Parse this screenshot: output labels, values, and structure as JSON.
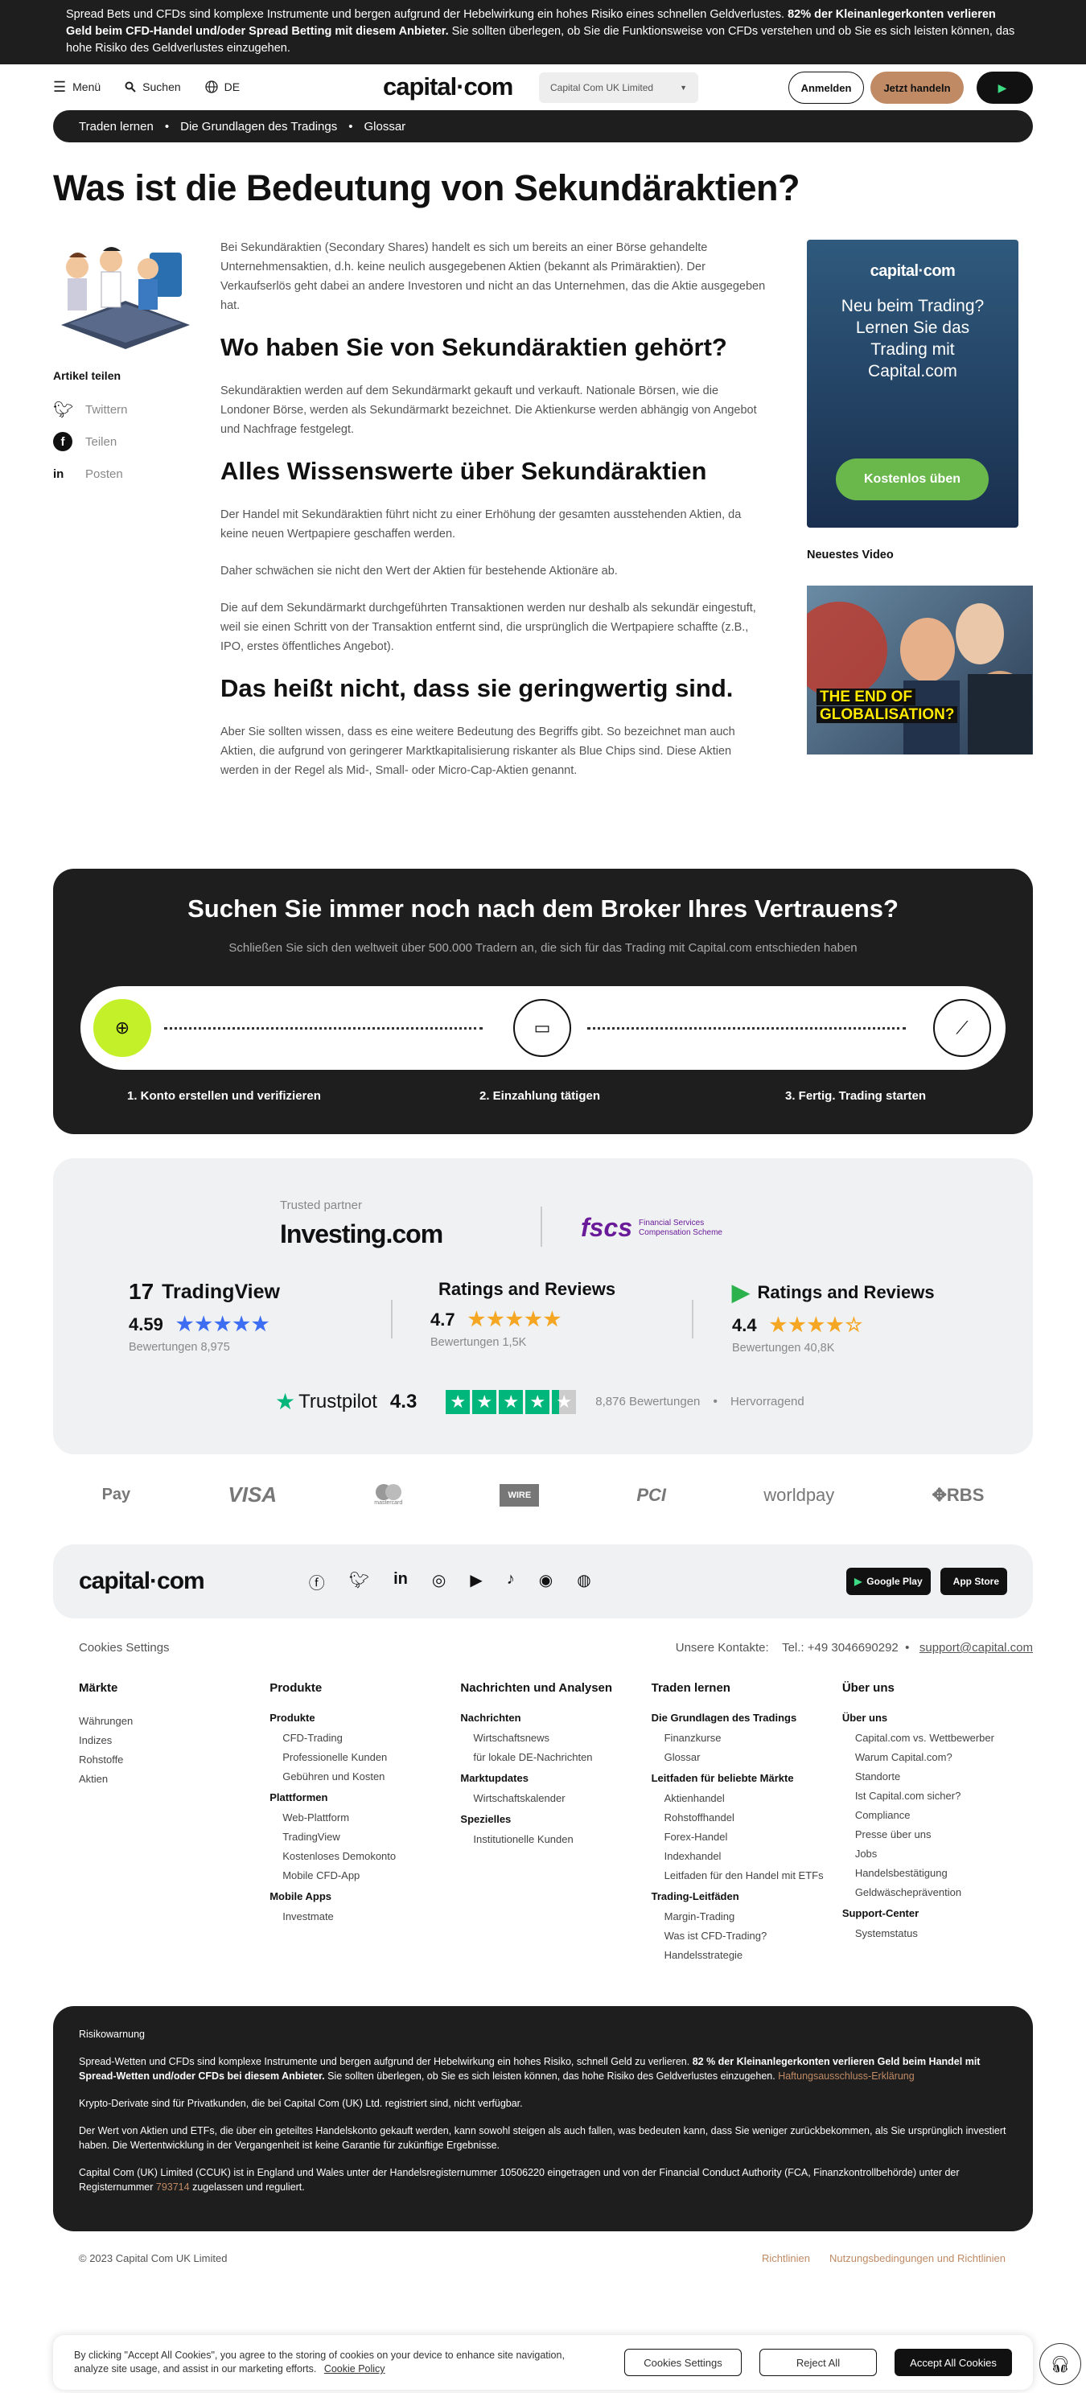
{
  "risk_banner": {
    "text": "Spread Bets und CFDs sind komplexe Instrumente und bergen aufgrund der Hebelwirkung ein hohes Risiko eines schnellen Geldverlustes.",
    "bold": "82% der Kleinanlegerkonten verlieren Geld beim CFD-Handel und/oder Spread Betting mit diesem Anbieter.",
    "rest": "Sie sollten überlegen, ob Sie die Funktionsweise von CFDs verstehen und ob Sie es sich leisten können, das hohe Risiko des Geldverlustes einzugehen."
  },
  "header": {
    "menu": "Menü",
    "search": "Suchen",
    "lang": "DE",
    "logo": "capital·com",
    "entity": "Capital Com UK Limited",
    "login": "Anmelden",
    "trade": "Jetzt handeln"
  },
  "breadcrumbs": [
    "Traden lernen",
    "Die Grundlagen des Tradings",
    "Glossar"
  ],
  "page_title": "Was ist die Bedeutung von Sekundäraktien?",
  "share": {
    "title": "Artikel teilen",
    "items": [
      "Twittern",
      "Teilen",
      "Posten"
    ]
  },
  "article": {
    "intro": "Bei Sekundäraktien (Secondary Shares) handelt es sich um bereits an einer Börse gehandelte Unternehmensaktien, d.h. keine neulich ausgegebenen Aktien (bekannt als Primäraktien). Der Verkaufserlös geht dabei an andere Investoren und nicht an das Unternehmen, das die Aktie ausgegeben hat.",
    "h2_1": "Wo haben Sie von Sekundäraktien gehört?",
    "p1": "Sekundäraktien werden auf dem Sekundärmarkt gekauft und verkauft. Nationale Börsen, wie die Londoner Börse, werden als Sekundärmarkt bezeichnet. Die Aktienkurse werden abhängig von Angebot und Nachfrage festgelegt.",
    "h2_2": "Alles Wissenswerte über Sekundäraktien",
    "p2": "Der Handel mit Sekundäraktien führt nicht zu einer Erhöhung der gesamten ausstehenden Aktien, da keine neuen Wertpapiere geschaffen werden.",
    "p3": "Daher schwächen sie nicht den Wert der Aktien für bestehende Aktionäre ab.",
    "p4": "Die auf dem Sekundärmarkt durchgeführten Transaktionen werden nur deshalb als sekundär eingestuft, weil sie einen Schritt von der Transaktion entfernt sind, die ursprünglich die Wertpapiere schaffte (z.B., IPO, erstes öffentliches Angebot).",
    "h2_3": "Das heißt nicht, dass sie geringwertig sind.",
    "p5": "Aber Sie sollten wissen, dass es eine weitere Bedeutung des Begriffs gibt. So bezeichnet man auch Aktien, die aufgrund von geringerer Marktkapitalisierung riskanter als Blue Chips sind. Diese Aktien werden in der Regel als Mid-, Small- oder Micro-Cap-Aktien genannt."
  },
  "promo": {
    "logo": "capital·com",
    "text": "Neu beim Trading? Lernen Sie das Trading mit Capital.com",
    "button": "Kostenlos üben"
  },
  "video": {
    "title": "Neuestes Video",
    "caption1": "THE END OF",
    "caption2": "GLOBALISATION?"
  },
  "broker": {
    "title": "Suchen Sie immer noch nach dem Broker Ihres Vertrauens?",
    "subtitle": "Schließen Sie sich den weltweit über 500.000 Tradern an, die sich für das Trading mit Capital.com entschieden haben",
    "steps": [
      "1. Konto erstellen und verifizieren",
      "2. Einzahlung tätigen",
      "3. Fertig. Trading starten"
    ]
  },
  "trust": {
    "partner_label": "Trusted partner",
    "partner": "Investing.com",
    "fscs": "fscs",
    "fscs_sub1": "Financial Services",
    "fscs_sub2": "Compensation Scheme",
    "ratings": [
      {
        "name": "TradingView",
        "score": "4.59",
        "count": "Bewertungen 8,975",
        "stars": "★★★★★",
        "star_color": "#3d6df2"
      },
      {
        "name": "Ratings and Reviews",
        "score": "4.7",
        "count": "Bewertungen 1,5K",
        "stars": "★★★★★",
        "star_color": "#f5a623"
      },
      {
        "name": "Ratings and Reviews",
        "score": "4.4",
        "count": "Bewertungen 40,8K",
        "stars": "★★★★☆",
        "star_color": "#f5a623"
      }
    ],
    "trustpilot": {
      "name": "Trustpilot",
      "score": "4.3",
      "count": "8,876 Bewertungen",
      "label": "Hervorragend"
    }
  },
  "payments": [
    "Pay",
    "VISA",
    "mastercard",
    "WIRE",
    "PCI",
    "worldpay",
    "RBS"
  ],
  "footer": {
    "logo": "capital·com",
    "google_play": "Google Play",
    "app_store": "App Store",
    "cookies": "Cookies Settings",
    "contacts_label": "Unsere Kontakte:",
    "phone": "Tel.: +49 3046690292",
    "email": "support@capital.com",
    "columns": [
      {
        "title": "Märkte",
        "groups": [
          {
            "sub": "",
            "items": [
              "Währungen",
              "Indizes",
              "Rohstoffe",
              "Aktien"
            ]
          }
        ]
      },
      {
        "title": "Produkte",
        "groups": [
          {
            "sub": "Produkte",
            "items": [
              "CFD-Trading",
              "Professionelle Kunden",
              "Gebühren und Kosten"
            ]
          },
          {
            "sub": "Plattformen",
            "items": [
              "Web-Plattform",
              "TradingView",
              "Kostenloses Demokonto",
              "Mobile CFD-App"
            ]
          },
          {
            "sub": "Mobile Apps",
            "items": [
              "Investmate"
            ]
          }
        ]
      },
      {
        "title": "Nachrichten und Analysen",
        "groups": [
          {
            "sub": "Nachrichten",
            "items": [
              "Wirtschaftsnews",
              "für lokale DE-Nachrichten"
            ]
          },
          {
            "sub": "Marktupdates",
            "items": [
              "Wirtschaftskalender"
            ]
          },
          {
            "sub": "Spezielles",
            "items": [
              "Institutionelle Kunden"
            ]
          }
        ]
      },
      {
        "title": "Traden lernen",
        "groups": [
          {
            "sub": "Die Grundlagen des Tradings",
            "items": [
              "Finanzkurse",
              "Glossar"
            ]
          },
          {
            "sub": "Leitfaden für beliebte Märkte",
            "items": [
              "Aktienhandel",
              "Rohstoffhandel",
              "Forex-Handel",
              "Indexhandel",
              "Leitfaden für den Handel mit ETFs"
            ]
          },
          {
            "sub": "Trading-Leitfäden",
            "items": [
              "Margin-Trading",
              "Was ist CFD-Trading?",
              "Handelsstrategie"
            ]
          }
        ]
      },
      {
        "title": "Über uns",
        "groups": [
          {
            "sub": "Über uns",
            "items": [
              "Capital.com vs. Wettbewerber",
              "Warum Capital.com?",
              "Standorte",
              "Ist Capital.com sicher?",
              "Compliance",
              "Presse über uns",
              "Jobs",
              "Handelsbestätigung",
              "Geldwäscheprävention"
            ]
          },
          {
            "sub": "Support-Center",
            "items": [
              "Systemstatus"
            ]
          }
        ]
      }
    ]
  },
  "risk_box": {
    "title": "Risikowarnung",
    "p1a": "Spread-Wetten und CFDs sind komplexe Instrumente und bergen aufgrund der Hebelwirkung ein hohes Risiko, schnell Geld zu verlieren.",
    "p1b": "82 % der Kleinanlegerkonten verlieren Geld beim Handel mit Spread-Wetten und/oder CFDs bei diesem Anbieter.",
    "p1c": "Sie sollten überlegen, ob Sie es sich leisten können, das hohe Risiko des Geldverlustes einzugehen.",
    "p1link": "Haftungsausschluss-Erklärung",
    "p2": "Krypto-Derivate sind für Privatkunden, die bei Capital Com (UK) Ltd. registriert sind, nicht verfügbar.",
    "p3": "Der Wert von Aktien und ETFs, die über ein geteiltes Handelskonto gekauft werden, kann sowohl steigen als auch fallen, was bedeuten kann, dass Sie weniger zurückbekommen, als Sie ursprünglich investiert haben. Die Wertentwicklung in der Vergangenheit ist keine Garantie für zukünftige Ergebnisse.",
    "p4a": "Capital Com (UK) Limited (CCUK) ist in England und Wales unter der Handelsregisternummer 10506220 eingetragen und von der Financial Conduct Authority (FCA, Finanzkontrollbehörde) unter der Registernummer",
    "p4link": "793714",
    "p4b": "zugelassen und reguliert."
  },
  "bottom": {
    "copyright": "© 2023 Capital Com UK Limited",
    "links": [
      "Richtlinien",
      "Nutzungsbedingungen und Richtlinien"
    ]
  },
  "cookie_banner": {
    "text1": "By clicking \"Accept All Cookies\", you agree to the storing of cookies on your device to enhance site navigation,",
    "text2": "analyze site usage, and assist in our marketing efforts.",
    "policy": "Cookie Policy",
    "settings": "Cookies Settings",
    "reject": "Reject All",
    "accept": "Accept All Cookies"
  }
}
